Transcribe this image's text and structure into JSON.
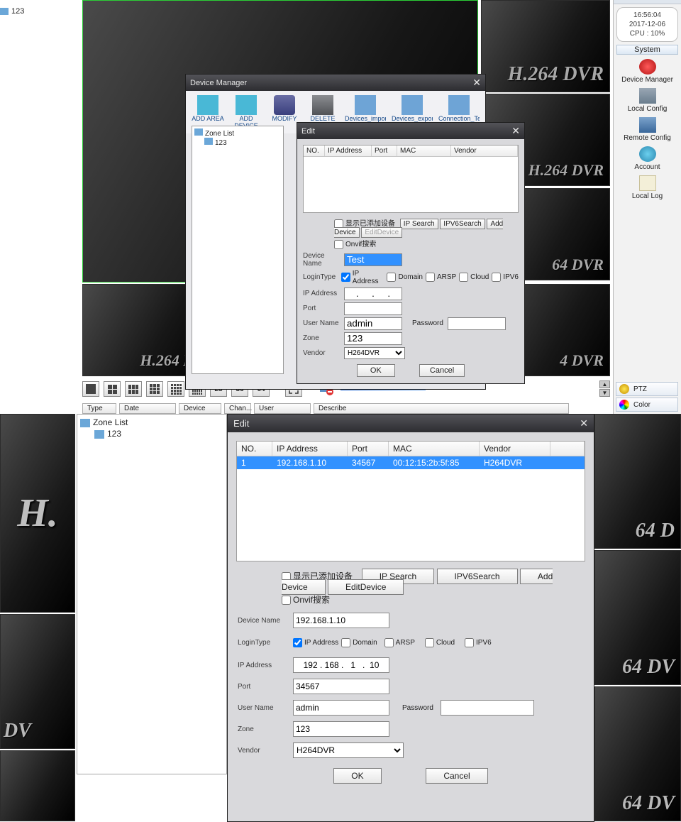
{
  "desk_tree_item": "123",
  "watermark": "H.264 DVR",
  "watermark_short": "H.",
  "clock": {
    "time": "16:56:04",
    "date": "2017-12-06",
    "cpu": "CPU : 10%"
  },
  "sidebar": {
    "header": "System",
    "items": [
      {
        "label": "Device Manager",
        "color": "#d62121"
      },
      {
        "label": "Local Config",
        "color": "#6f8aa5"
      },
      {
        "label": "Remote Config",
        "color": "#4d7fb2"
      },
      {
        "label": "Account",
        "color": "#4aa0c6"
      },
      {
        "label": "Local Log",
        "color": "#d8c77a"
      }
    ],
    "mini": [
      {
        "label": "PTZ"
      },
      {
        "label": "Color"
      }
    ]
  },
  "viewbar_nums": [
    "25",
    "36",
    "64"
  ],
  "log_headers": [
    "Type",
    "Date",
    "Device",
    "Chan...",
    "User",
    "Describe"
  ],
  "devmgr": {
    "title": "Device Manager",
    "tools": [
      "ADD AREA",
      "ADD DEVICE",
      "MODIFY",
      "DELETE",
      "Devices_import",
      "Devices_export",
      "Connection_Test"
    ],
    "tree": {
      "root": "Zone List",
      "child": "123"
    }
  },
  "edit_small": {
    "title": "Edit",
    "cols": [
      "NO.",
      "IP Address",
      "Port",
      "MAC",
      "Vendor"
    ],
    "chk1": "显示已添加设备",
    "chk2": "Onvif搜索",
    "btns": [
      "IP Search",
      "IPV6Search",
      "Add Device",
      "EditDevice"
    ],
    "labels": {
      "devname": "Device Name",
      "logintype": "LoginType",
      "ip": "IP Address",
      "port": "Port",
      "user": "User Name",
      "pwd": "Password",
      "zone": "Zone",
      "vendor": "Vendor"
    },
    "login_opts": [
      "IP Address",
      "Domain",
      "ARSP",
      "Cloud",
      "IPV6"
    ],
    "vals": {
      "devname": "Test",
      "user": "admin",
      "zone": "123",
      "vendor": "H264DVR"
    },
    "ok": "OK",
    "cancel": "Cancel"
  },
  "edit_large": {
    "title": "Edit",
    "cols": [
      "NO.",
      "IP Address",
      "Port",
      "MAC",
      "Vendor"
    ],
    "row": {
      "no": "1",
      "ip": "192.168.1.10",
      "port": "34567",
      "mac": "00:12:15:2b:5f:85",
      "vendor": "H264DVR"
    },
    "chk1": "显示已添加设备",
    "chk2": "Onvif搜索",
    "btns": [
      "IP Search",
      "IPV6Search",
      "Add Device",
      "EditDevice"
    ],
    "labels": {
      "devname": "Device Name",
      "logintype": "LoginType",
      "ip": "IP Address",
      "port": "Port",
      "user": "User Name",
      "pwd": "Password",
      "zone": "Zone",
      "vendor": "Vendor"
    },
    "login_opts": [
      "IP Address",
      "Domain",
      "ARSP",
      "Cloud",
      "IPV6"
    ],
    "vals": {
      "devname": "192.168.1.10",
      "ip": "192 . 168 .   1   .  10",
      "port": "34567",
      "user": "admin",
      "zone": "123",
      "vendor": "H264DVR"
    },
    "ok": "OK",
    "cancel": "Cancel"
  },
  "btree": {
    "root": "Zone List",
    "child": "123"
  }
}
